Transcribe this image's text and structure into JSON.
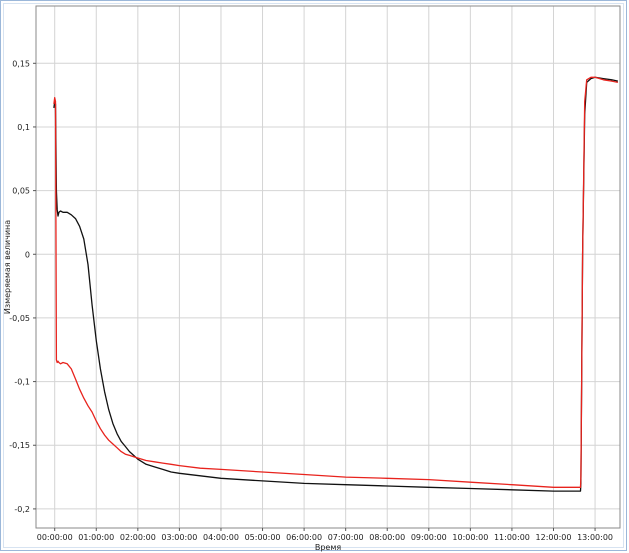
{
  "chart_data": {
    "type": "line",
    "title": "",
    "xlabel": "Время",
    "ylabel": "Измеряемая величина",
    "x_unit": "hours",
    "xlim": [
      -0.45,
      13.6
    ],
    "ylim": [
      -0.215,
      0.195
    ],
    "grid": true,
    "legend": "none",
    "x_ticks": [
      {
        "value": 0,
        "label": "00:00:00"
      },
      {
        "value": 1,
        "label": "01:00:00"
      },
      {
        "value": 2,
        "label": "02:00:00"
      },
      {
        "value": 3,
        "label": "03:00:00"
      },
      {
        "value": 4,
        "label": "04:00:00"
      },
      {
        "value": 5,
        "label": "05:00:00"
      },
      {
        "value": 6,
        "label": "06:00:00"
      },
      {
        "value": 7,
        "label": "07:00:00"
      },
      {
        "value": 8,
        "label": "08:00:00"
      },
      {
        "value": 9,
        "label": "09:00:00"
      },
      {
        "value": 10,
        "label": "10:00:00"
      },
      {
        "value": 11,
        "label": "11:00:00"
      },
      {
        "value": 12,
        "label": "12:00:00"
      },
      {
        "value": 13,
        "label": "13:00:00"
      }
    ],
    "y_ticks": [
      {
        "value": 0.15,
        "label": "0,15"
      },
      {
        "value": 0.1,
        "label": "0,1"
      },
      {
        "value": 0.05,
        "label": "0,05"
      },
      {
        "value": 0,
        "label": "0"
      },
      {
        "value": -0.05,
        "label": "-0,05"
      },
      {
        "value": -0.1,
        "label": "-0,1"
      },
      {
        "value": -0.15,
        "label": "-0,15"
      },
      {
        "value": -0.2,
        "label": "-0,2"
      }
    ],
    "series": [
      {
        "color": "#111111",
        "x": [
          -0.02,
          0.0,
          0.02,
          0.04,
          0.06,
          0.08,
          0.1,
          0.14,
          0.2,
          0.3,
          0.4,
          0.5,
          0.6,
          0.7,
          0.8,
          0.9,
          1.0,
          1.1,
          1.2,
          1.3,
          1.4,
          1.5,
          1.6,
          1.7,
          1.8,
          1.9,
          2.0,
          2.2,
          2.4,
          2.6,
          2.8,
          3.0,
          3.5,
          4.0,
          5.0,
          6.0,
          7.0,
          8.0,
          9.0,
          10.0,
          11.0,
          12.0,
          12.65,
          12.66,
          12.7,
          12.75,
          12.8,
          12.9,
          13.0,
          13.2,
          13.4,
          13.55
        ],
        "y": [
          0.115,
          0.12,
          0.118,
          0.05,
          0.035,
          0.03,
          0.033,
          0.034,
          0.033,
          0.033,
          0.031,
          0.028,
          0.022,
          0.012,
          -0.008,
          -0.04,
          -0.068,
          -0.09,
          -0.108,
          -0.122,
          -0.133,
          -0.141,
          -0.147,
          -0.151,
          -0.155,
          -0.158,
          -0.161,
          -0.165,
          -0.167,
          -0.169,
          -0.171,
          -0.172,
          -0.174,
          -0.176,
          -0.178,
          -0.18,
          -0.181,
          -0.182,
          -0.183,
          -0.184,
          -0.185,
          -0.186,
          -0.186,
          -0.18,
          0.0,
          0.11,
          0.135,
          0.138,
          0.139,
          0.138,
          0.137,
          0.136
        ]
      },
      {
        "color": "#e8231d",
        "x": [
          -0.02,
          0.0,
          0.02,
          0.04,
          0.06,
          0.08,
          0.1,
          0.14,
          0.2,
          0.3,
          0.4,
          0.5,
          0.6,
          0.7,
          0.8,
          0.9,
          1.0,
          1.1,
          1.2,
          1.3,
          1.4,
          1.5,
          1.6,
          1.7,
          1.8,
          1.9,
          2.0,
          2.2,
          2.4,
          2.6,
          2.8,
          3.0,
          3.5,
          4.0,
          5.0,
          6.0,
          7.0,
          8.0,
          9.0,
          10.0,
          11.0,
          12.0,
          12.65,
          12.66,
          12.7,
          12.75,
          12.8,
          12.9,
          13.0,
          13.2,
          13.4,
          13.55
        ],
        "y": [
          0.118,
          0.123,
          0.12,
          -0.083,
          -0.085,
          -0.084,
          -0.085,
          -0.086,
          -0.085,
          -0.086,
          -0.09,
          -0.098,
          -0.106,
          -0.113,
          -0.119,
          -0.124,
          -0.131,
          -0.137,
          -0.142,
          -0.146,
          -0.149,
          -0.152,
          -0.155,
          -0.157,
          -0.158,
          -0.159,
          -0.16,
          -0.162,
          -0.163,
          -0.164,
          -0.165,
          -0.166,
          -0.168,
          -0.169,
          -0.171,
          -0.173,
          -0.175,
          -0.176,
          -0.177,
          -0.179,
          -0.181,
          -0.183,
          -0.183,
          -0.175,
          0.0,
          0.12,
          0.137,
          0.139,
          0.139,
          0.137,
          0.136,
          0.135
        ]
      }
    ]
  }
}
